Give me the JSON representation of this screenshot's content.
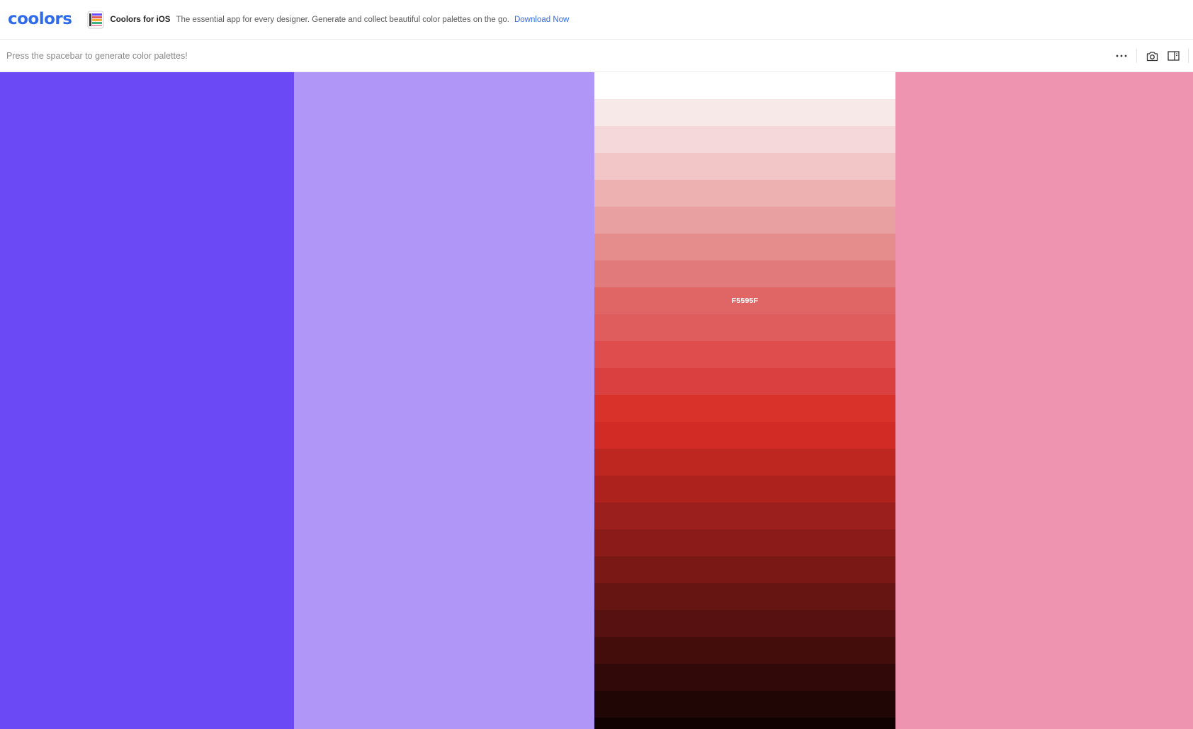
{
  "header": {
    "logo_text": "coolors",
    "logo_color": "#2f6bea",
    "promo_icon": "coolors-app-icon",
    "promo_title": "Coolors for iOS",
    "promo_text": "The essential app for every designer. Generate and collect beautiful color palettes on the go.",
    "promo_link": "Download Now",
    "link_color": "#2f6bea"
  },
  "toolbar": {
    "hint": "Press the spacebar to generate color palettes!",
    "icons": [
      "more-options-icon",
      "camera-icon",
      "sidebar-toggle-icon"
    ]
  },
  "palette": {
    "columns": [
      {
        "color": "#6b4af6"
      },
      {
        "color": "#b096f7"
      },
      {
        "color": "#e05a5a",
        "mode": "shades"
      },
      {
        "color": "#ee94b1"
      }
    ],
    "shades": [
      "#ffffff",
      "#f8e9e9",
      "#f5d8d9",
      "#f2c5c6",
      "#edb1b1",
      "#e9a0a0",
      "#e58c8c",
      "#e17b7b",
      "#e06666",
      "#df5d5d",
      "#df4d4d",
      "#da4040",
      "#d9322b",
      "#d22a25",
      "#be2720",
      "#ad221d",
      "#9b1f1c",
      "#8a1b18",
      "#7a1816",
      "#661512",
      "#561110",
      "#430d0c",
      "#310908",
      "#210606",
      "#110202"
    ],
    "selected_shade_index": 8,
    "selected_label": "F5595F",
    "selected_label_color": "#ffffff"
  }
}
